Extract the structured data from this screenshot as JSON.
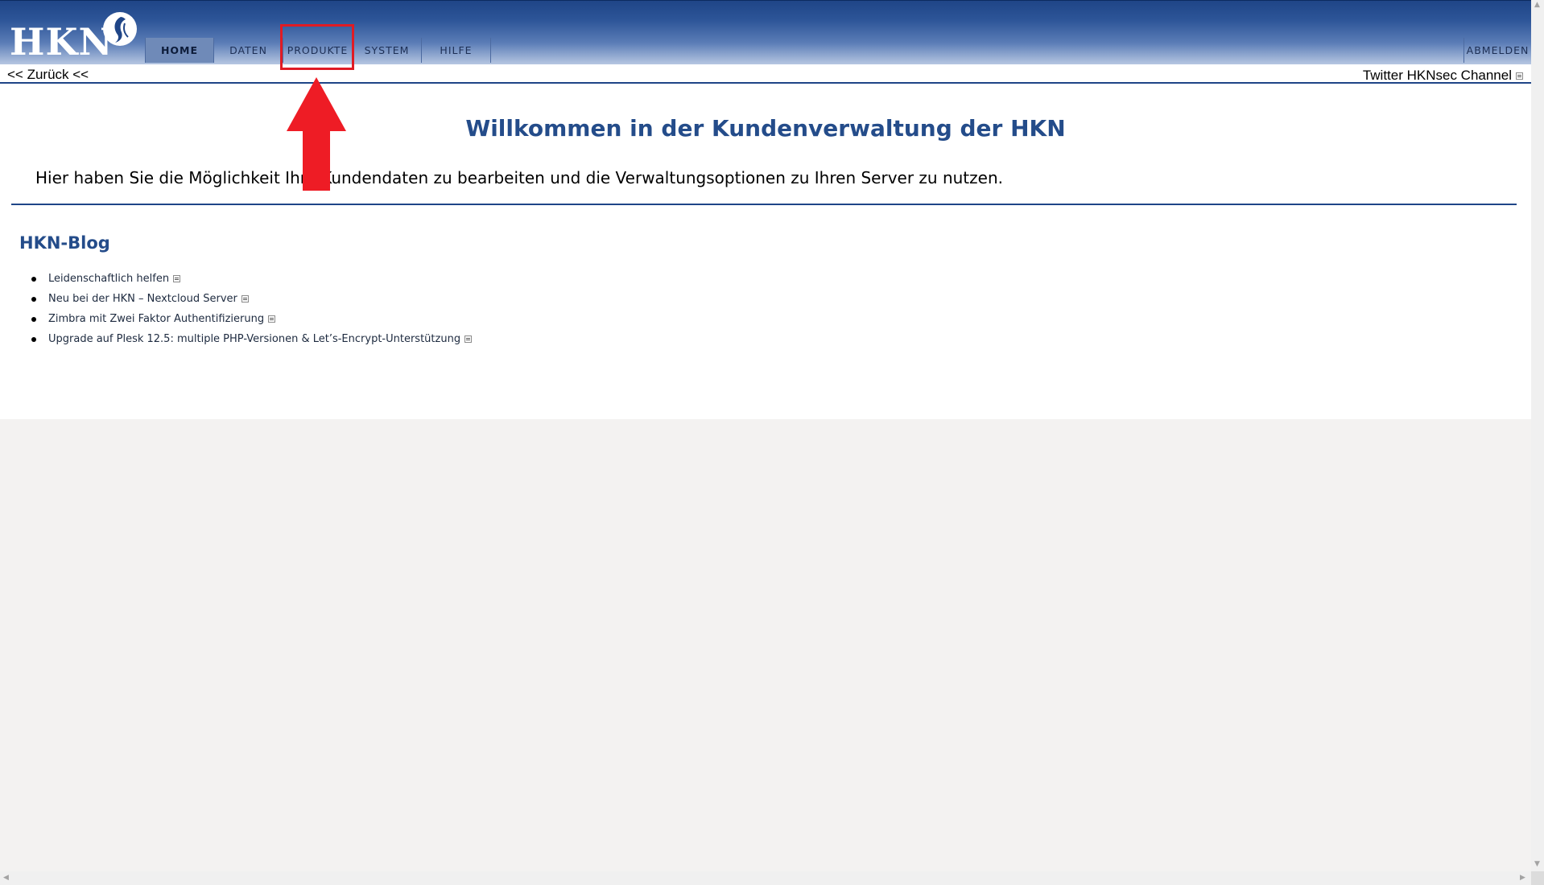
{
  "header": {
    "logo_text": "HKN",
    "nav_tabs": [
      {
        "label": "HOME",
        "active": true
      },
      {
        "label": "DATEN",
        "active": false
      },
      {
        "label": "PRODUKTE",
        "active": false
      },
      {
        "label": "SYSTEM",
        "active": false
      },
      {
        "label": "HILFE",
        "active": false
      }
    ],
    "logout_label": "ABMELDEN"
  },
  "subbar": {
    "back_label": "<< Zurück <<",
    "twitter_label": "Twitter HKNsec Channel"
  },
  "main": {
    "title": "Willkommen in der Kundenverwaltung der HKN",
    "intro": "Hier haben Sie die Möglichkeit Ihre Kundendaten zu bearbeiten und die Verwaltungsoptionen zu Ihren Server zu nutzen."
  },
  "blog": {
    "title": "HKN-Blog",
    "items": [
      {
        "label": "Leidenschaftlich helfen"
      },
      {
        "label": "Neu bei der HKN – Nextcloud Server"
      },
      {
        "label": "Zimbra mit Zwei Faktor Authentifizierung"
      },
      {
        "label": "Upgrade auf Plesk 12.5: multiple PHP-Versionen & Let’s-Encrypt-Unterstützung"
      }
    ]
  },
  "annotation": {
    "highlight_color": "#e01b24",
    "highlight_target": "PRODUKTE"
  },
  "colors": {
    "brand_blue": "#244c8a",
    "header_dark": "#1f4587"
  }
}
